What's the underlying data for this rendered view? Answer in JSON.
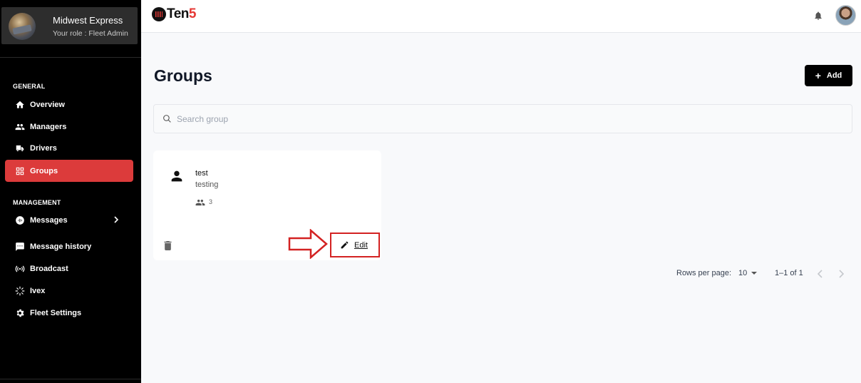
{
  "org": {
    "name": "Midwest Express",
    "role": "Your role : Fleet Admin"
  },
  "sidebar": {
    "general_label": "GENERAL",
    "management_label": "MANAGEMENT",
    "general_items": [
      {
        "label": "Overview",
        "icon": "home-icon"
      },
      {
        "label": "Managers",
        "icon": "people-icon"
      },
      {
        "label": "Drivers",
        "icon": "truck-icon"
      },
      {
        "label": "Groups",
        "icon": "grid-icon",
        "active": true
      }
    ],
    "management_items": [
      {
        "label": "Messages",
        "icon": "audio-message-icon"
      },
      {
        "label": "Message history",
        "icon": "chat-icon"
      },
      {
        "label": "Broadcast",
        "icon": "broadcast-icon"
      },
      {
        "label": "Ivex",
        "icon": "spinner-icon"
      },
      {
        "label": "Fleet Settings",
        "icon": "gear-icon"
      }
    ]
  },
  "header": {
    "logo_text": "Ten",
    "logo_accent": "5"
  },
  "main": {
    "title": "Groups",
    "add_label": "Add",
    "search_placeholder": "Search group",
    "groups": [
      {
        "name": "test",
        "description": "testing",
        "member_count": "3",
        "edit_label": "Edit"
      }
    ]
  },
  "pagination": {
    "rows_label": "Rows per page:",
    "rows_value": "10",
    "range": "1–1 of 1"
  },
  "colors": {
    "accent": "#dc3b3b",
    "brand_red": "#e53935",
    "sidebar_bg": "#000000",
    "annotation": "#d32222"
  }
}
